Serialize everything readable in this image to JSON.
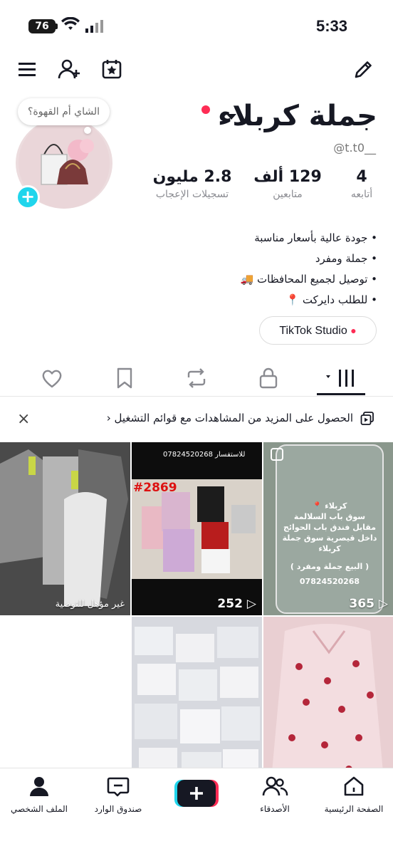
{
  "status_bar": {
    "battery": "76",
    "time": "5:33"
  },
  "profile": {
    "name": "جملة كربلاء",
    "handle": "@t.t0__",
    "note_bubble": "الشاي أم القهوة؟",
    "stats": [
      {
        "num": "4",
        "label": "أتابعه"
      },
      {
        "num": "129 ألف",
        "label": "متابعين"
      },
      {
        "num": "2.8 مليون",
        "label": "تسجيلات الإعجاب"
      }
    ],
    "bio": [
      "• جودة عالية بأسعار مناسبة",
      "• جملة ومفرد",
      "• توصيل لجميع المحافظات 🚚",
      "• للطلب دايركت 📍"
    ],
    "studio_button": "TikTok Studio"
  },
  "banner": {
    "text": "الحصول على المزيد من المشاهدات مع قوائم التشغيل  ‹"
  },
  "videos": [
    {
      "note": "غير مؤهل للتوصية",
      "views": ""
    },
    {
      "views": "252"
    },
    {
      "views": "365"
    },
    {
      "views": ""
    },
    {
      "views": ""
    },
    {
      "views": ""
    }
  ],
  "tile_texts": {
    "t2_top": "07824520268 للاستفسار",
    "t2_code": "#2869",
    "t3_lines": [
      "كربلاء 📍",
      "سوق باب السلالمة",
      "مقابل فندق باب الحوائج",
      "داخل قيصرية سوق جملة",
      "كربلاء",
      "( البيع جملة ومفرد )",
      "07824520268"
    ]
  },
  "nav": {
    "home": "الصفحة الرئيسية",
    "friends": "الأصدقاء",
    "inbox": "صندوق الوارد",
    "profile": "الملف الشخصي"
  },
  "colors": {
    "accent_cyan": "#20d5ec",
    "accent_red": "#fe2c55"
  }
}
